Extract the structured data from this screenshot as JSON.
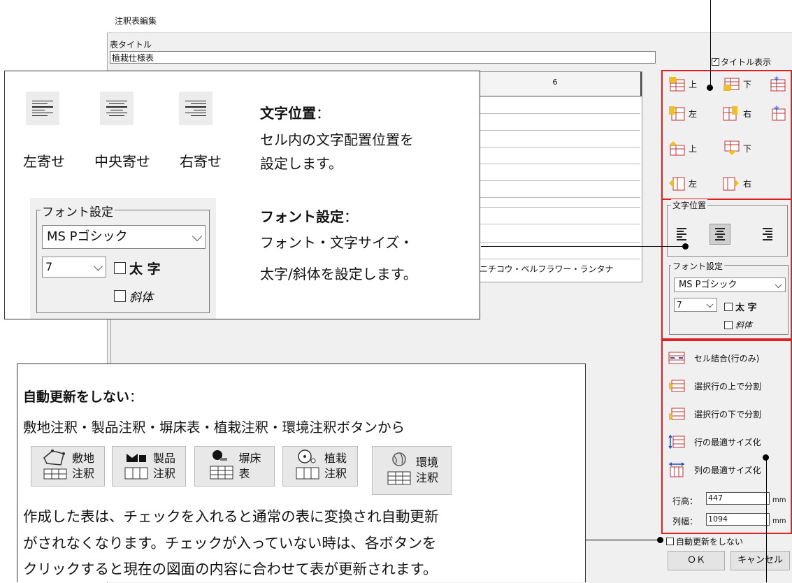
{
  "dialog": {
    "title": "注釈表編集",
    "title_label": "表タイトル",
    "title_value": "植栽仕様表",
    "show_title_label": "タイトル表示",
    "show_title_checked": true,
    "column_header": "6",
    "cell_preview": "ニチコウ・ベルフラワー・ランタナ",
    "row_tools": {
      "insert_above": "上",
      "insert_below": "下",
      "insert_left": "左",
      "insert_right": "右",
      "move_up": "上",
      "move_down": "下",
      "move_left": "左",
      "move_right": "右"
    },
    "text_position_label": "文字位置",
    "font_group_label": "フォント設定",
    "font_name": "MS Pゴシック",
    "font_size": "7",
    "bold_label": "太 字",
    "italic_label": "斜体",
    "cell_ops": [
      "セル結合(行のみ)",
      "選択行の上で分割",
      "選択行の下で分割",
      "行の最適サイズ化",
      "列の最適サイズ化"
    ],
    "row_height_label": "行高：",
    "row_height_value": "447",
    "col_width_label": "列幅：",
    "col_width_value": "1094",
    "unit": "mm",
    "no_auto_update_label": "自動更新をしない",
    "ok_label": "ＯＫ",
    "cancel_label": "キャンセル"
  },
  "callout_text": {
    "align_left": "左寄せ",
    "align_center": "中央寄せ",
    "align_right": "右寄せ",
    "pos_heading": "文字位置",
    "pos_colon": "：",
    "pos_desc1": "セル内の文字配置位置を",
    "pos_desc2": "設定します。",
    "font_heading": "フォント設定",
    "font_colon": "：",
    "font_desc1": "フォント・文字サイズ・",
    "font_desc2": "太字/斜体を設定します。",
    "font_group_label": "フォント設定",
    "font_name": "MS Pゴシック",
    "font_size": "7",
    "bold_label": "太 字",
    "italic_label": "斜体"
  },
  "callout_auto": {
    "heading": "自動更新をしない",
    "colon": "：",
    "line1": "敷地注釈・製品注釈・塀床表・植栽注釈・環境注釈ボタンから",
    "buttons": [
      {
        "top": "敷地",
        "bottom": "注釈"
      },
      {
        "top": "製品",
        "bottom": "注釈"
      },
      {
        "top": "塀床",
        "bottom": "表"
      },
      {
        "top": "植栽",
        "bottom": "注釈"
      },
      {
        "top": "環境",
        "bottom": "注釈"
      }
    ],
    "line2": "作成した表は、チェックを入れると通常の表に変換され自動更新",
    "line3": "がされなくなります。チェックが入っていない時は、各ボタンを",
    "line4": "クリックすると現在の図面の内容に合わせて表が更新されます。"
  }
}
